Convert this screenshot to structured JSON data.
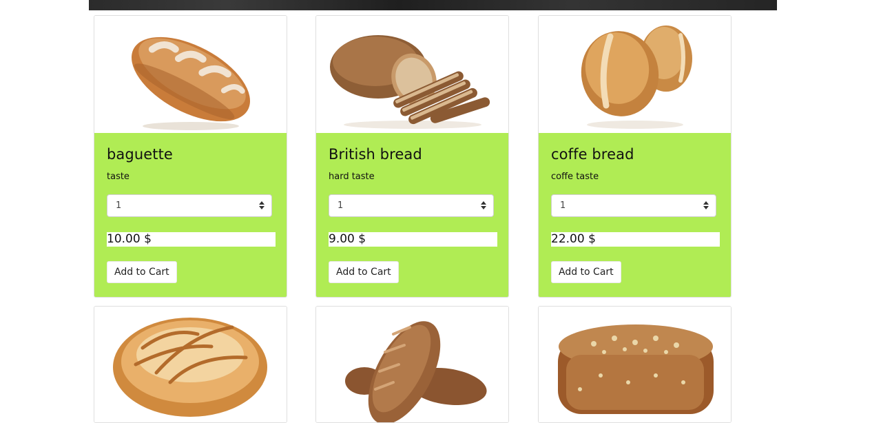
{
  "products": [
    {
      "name": "baguette",
      "description": "taste",
      "quantity": "1",
      "price": "10.00 $",
      "button": "Add to Cart",
      "icon": "bread-loaf-icon"
    },
    {
      "name": "British bread",
      "description": "hard taste",
      "quantity": "1",
      "price": "9.00 $",
      "button": "Add to Cart",
      "icon": "sliced-bread-icon"
    },
    {
      "name": "coffe bread",
      "description": "coffe taste",
      "quantity": "1",
      "price": "22.00 $",
      "button": "Add to Cart",
      "icon": "bread-rolls-icon"
    }
  ],
  "bottom_row_icons": [
    "round-bread-icon",
    "rye-bread-icon",
    "seeded-loaf-icon"
  ]
}
